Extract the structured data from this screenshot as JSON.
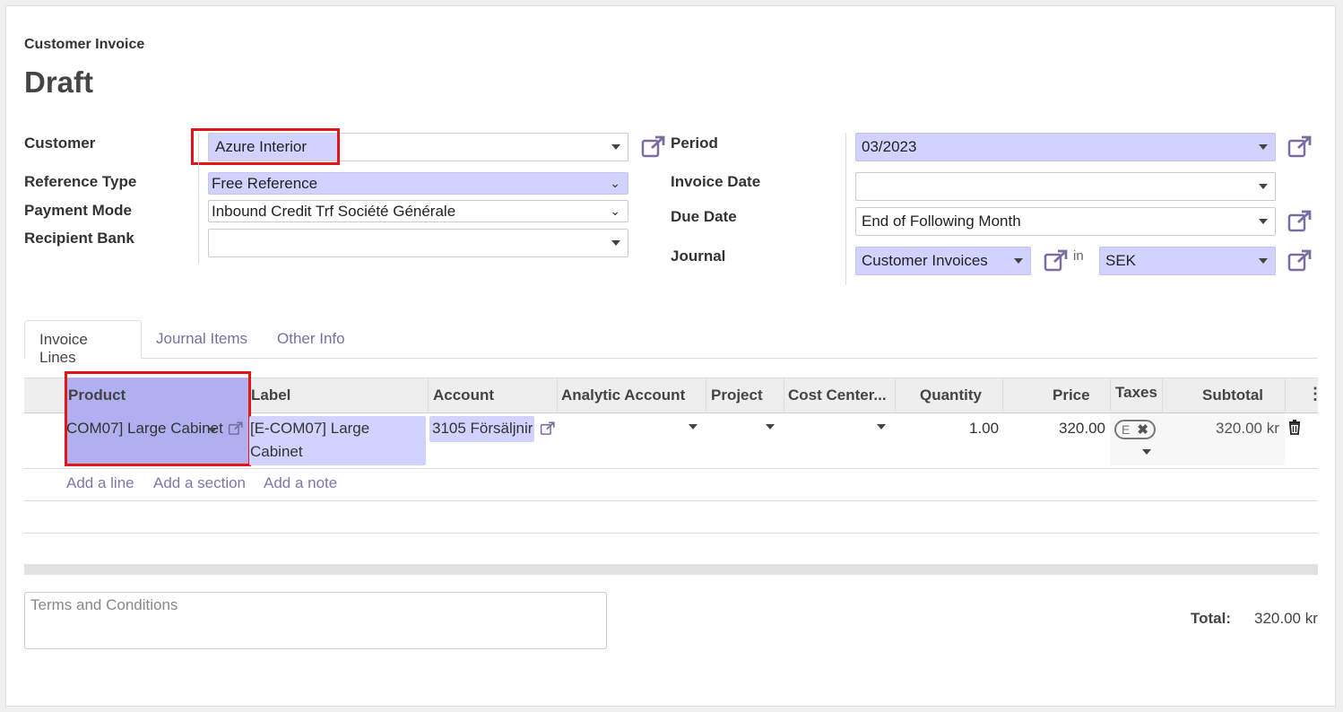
{
  "header": {
    "doc_type": "Customer Invoice",
    "doc_name": "Draft"
  },
  "left_fields": {
    "customer_label": "Customer",
    "customer_value": "Azure Interior",
    "reference_type_label": "Reference Type",
    "reference_type_value": "Free Reference",
    "payment_mode_label": "Payment Mode",
    "payment_mode_value": "Inbound Credit Trf Société Générale",
    "recipient_bank_label": "Recipient Bank",
    "recipient_bank_value": ""
  },
  "right_fields": {
    "period_label": "Period",
    "period_value": "03/2023",
    "invoice_date_label": "Invoice Date",
    "invoice_date_value": "",
    "due_date_label": "Due Date",
    "due_date_value": "End of Following Month",
    "journal_label": "Journal",
    "journal_value": "Customer Invoices",
    "in_label": "in",
    "currency_value": "SEK"
  },
  "tabs": [
    {
      "label": "Invoice Lines"
    },
    {
      "label": "Journal Items"
    },
    {
      "label": "Other Info"
    }
  ],
  "table": {
    "columns": [
      "Product",
      "Label",
      "Account",
      "Analytic Account",
      "Project",
      "Cost Center...",
      "Quantity",
      "Price",
      "Taxes",
      "Subtotal"
    ],
    "rows": [
      {
        "product": "COM07] Large Cabinet",
        "label_line1": "[E-COM07] Large",
        "label_line2": "Cabinet",
        "account": "3105 Försäljnir",
        "quantity": "1.00",
        "price": "320.00",
        "tax_tag": "E",
        "subtotal": "320.00 kr"
      }
    ]
  },
  "add_links": {
    "add_line": "Add a line",
    "add_section": "Add a section",
    "add_note": "Add a note"
  },
  "footer": {
    "terms_placeholder": "Terms and Conditions",
    "total_label": "Total:",
    "total_value": "320.00 kr"
  },
  "colors": {
    "required_bg": "#d2d2ff",
    "highlight_red": "#e5141b",
    "link": "#7a7aa8"
  }
}
